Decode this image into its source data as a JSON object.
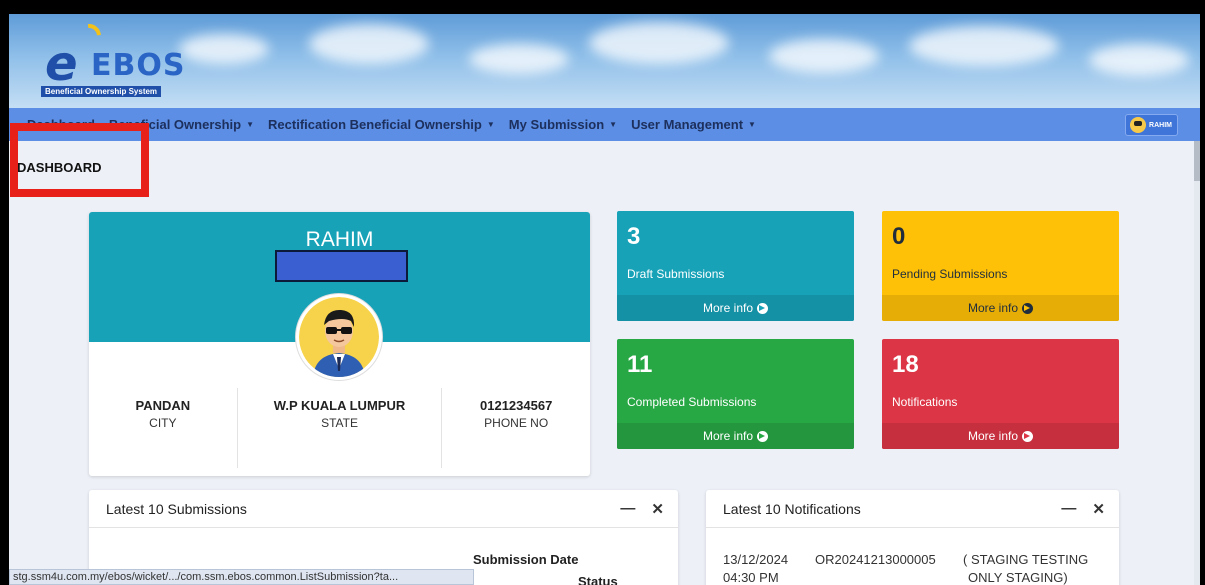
{
  "header": {
    "logo_main": "EBOS",
    "logo_tagline": "Beneficial Ownership System"
  },
  "nav": {
    "items": [
      {
        "label": "Dashboard",
        "has_caret": false
      },
      {
        "label": "Beneficial Ownership",
        "has_caret": true
      },
      {
        "label": "Rectification Beneficial Ownership",
        "has_caret": true
      },
      {
        "label": "My Submission",
        "has_caret": true
      },
      {
        "label": "User Management",
        "has_caret": true
      }
    ],
    "user": "RAHIM"
  },
  "page_title": "DASHBOARD",
  "profile": {
    "name": "RAHIM",
    "stats": [
      {
        "value": "PANDAN",
        "label": "CITY"
      },
      {
        "value": "W.P KUALA LUMPUR",
        "label": "STATE"
      },
      {
        "value": "0121234567",
        "label": "PHONE NO"
      }
    ]
  },
  "boxes": [
    {
      "count": "3",
      "label": "Draft Submissions",
      "footer": "More info",
      "color": "#17a2b8"
    },
    {
      "count": "0",
      "label": "Pending Submissions",
      "footer": "More info",
      "color": "#ffc107"
    },
    {
      "count": "11",
      "label": "Completed Submissions",
      "footer": "More info",
      "color": "#28a745"
    },
    {
      "count": "18",
      "label": "Notifications",
      "footer": "More info",
      "color": "#dc3545"
    }
  ],
  "submissions_panel": {
    "title": "Latest 10 Submissions",
    "columns": [
      "Submission Date",
      "Status"
    ]
  },
  "notifications_panel": {
    "title": "Latest 10 Notifications",
    "rows": [
      {
        "date": "13/12/2024",
        "time": "04:30 PM",
        "ref": "OR20241213000005",
        "message": "( STAGING TESTING",
        "message2": "ONLY STAGING)"
      }
    ]
  },
  "status_bar": "stg.ssm4u.com.my/ebos/wicket/.../com.ssm.ebos.common.ListSubmission?ta..."
}
